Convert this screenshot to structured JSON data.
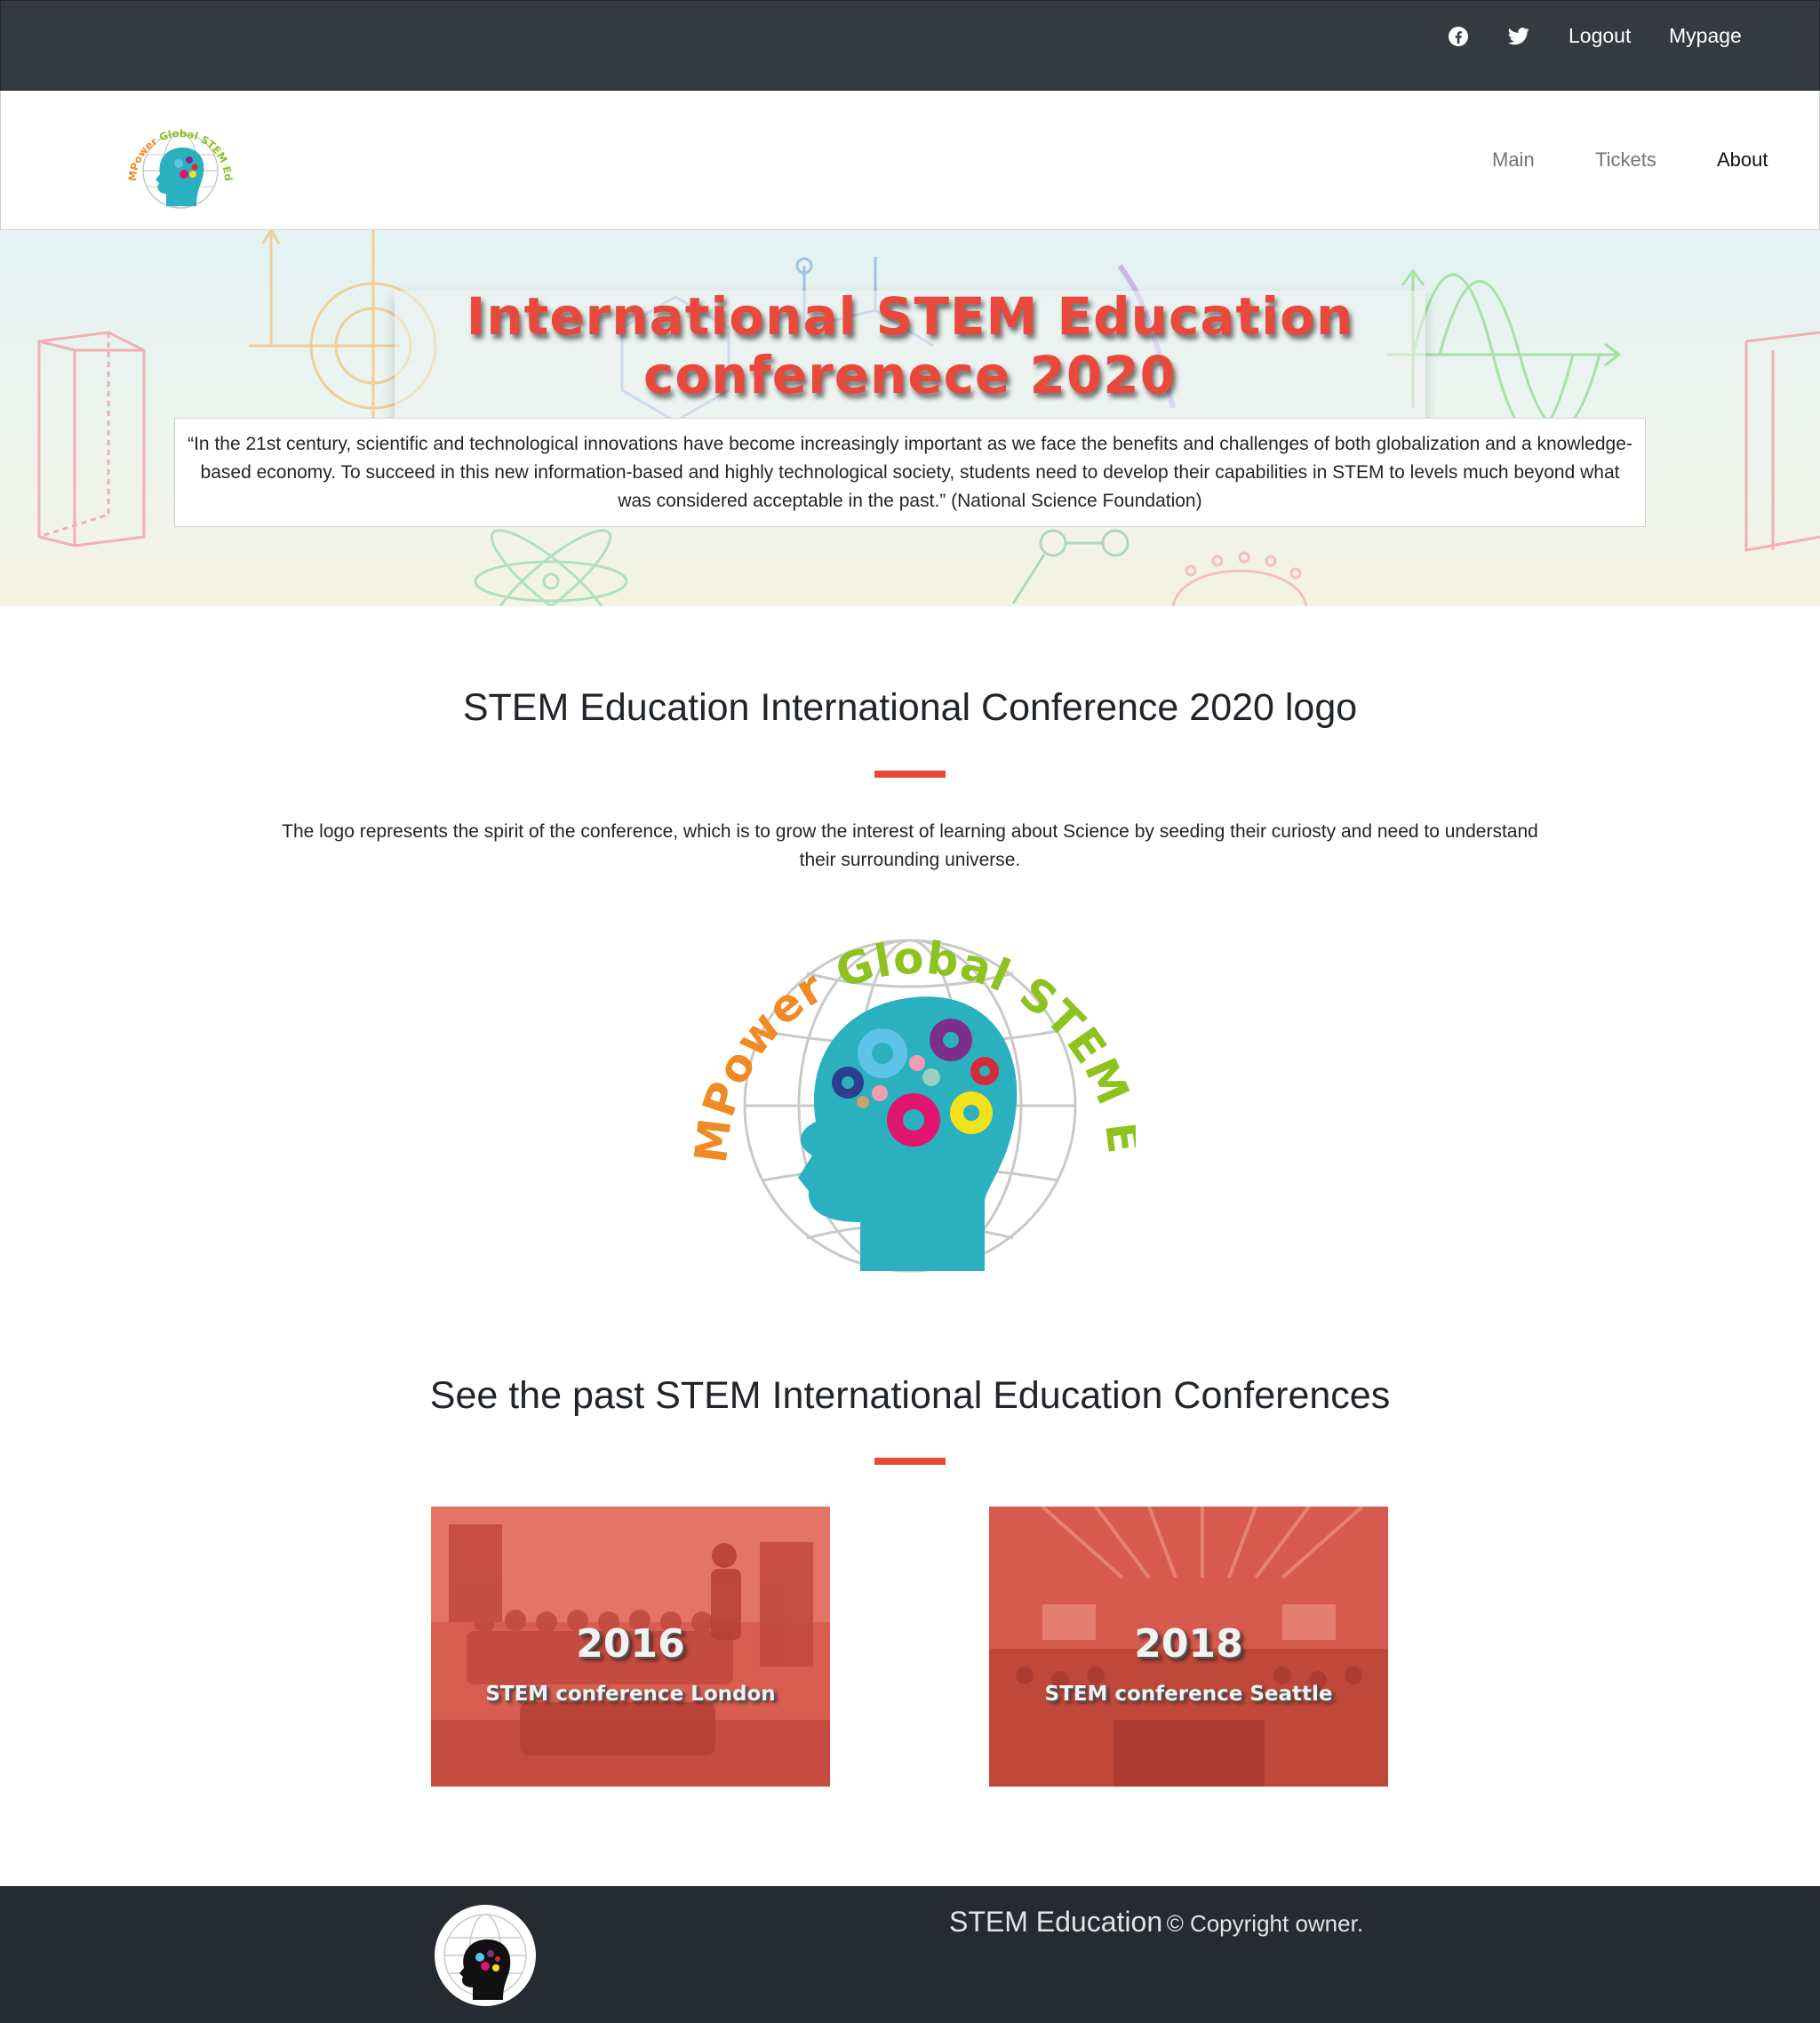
{
  "topbar": {
    "icons": [
      "facebook-icon",
      "twitter-icon"
    ],
    "logout": "Logout",
    "mypage": "Mypage"
  },
  "nav": {
    "logo_text": "MPower Global STEM Education",
    "items": [
      {
        "label": "Main"
      },
      {
        "label": "Tickets"
      },
      {
        "label": "About"
      }
    ],
    "active": "About"
  },
  "hero": {
    "title": "International STEM Education conferenece 2020",
    "quote": "“In the 21st century, scientific and technological innovations have become increasingly important as we face the benefits and challenges of both globalization and a knowledge-based economy. To succeed in this new information-based and highly technological society, students need to develop their capabilities in STEM to levels much beyond what was considered acceptable in the past.” (National Science Foundation)"
  },
  "logo_section": {
    "heading": "STEM Education International Conference 2020 logo",
    "description": "The logo represents the spirit of the conference, which is to grow the interest of learning about Science by seeding their curiosty and need to understand their surrounding universe.",
    "logo_text": "MPower Global STEM Education"
  },
  "past_section": {
    "heading": "See the past STEM International Education Conferences",
    "cards": [
      {
        "year": "2016",
        "subtitle": "STEM conference London"
      },
      {
        "year": "2018",
        "subtitle": "STEM conference Seattle"
      }
    ]
  },
  "footer": {
    "brand": "STEM Education",
    "copyright": "© Copyright owner."
  },
  "colors": {
    "accent": "#e8493a",
    "topbar": "#343a40",
    "footer": "#262a31",
    "card_overlay": "#d4574a",
    "logo_green": "#8dc21f",
    "logo_orange": "#f08a24",
    "logo_teal": "#2bb0bf"
  }
}
